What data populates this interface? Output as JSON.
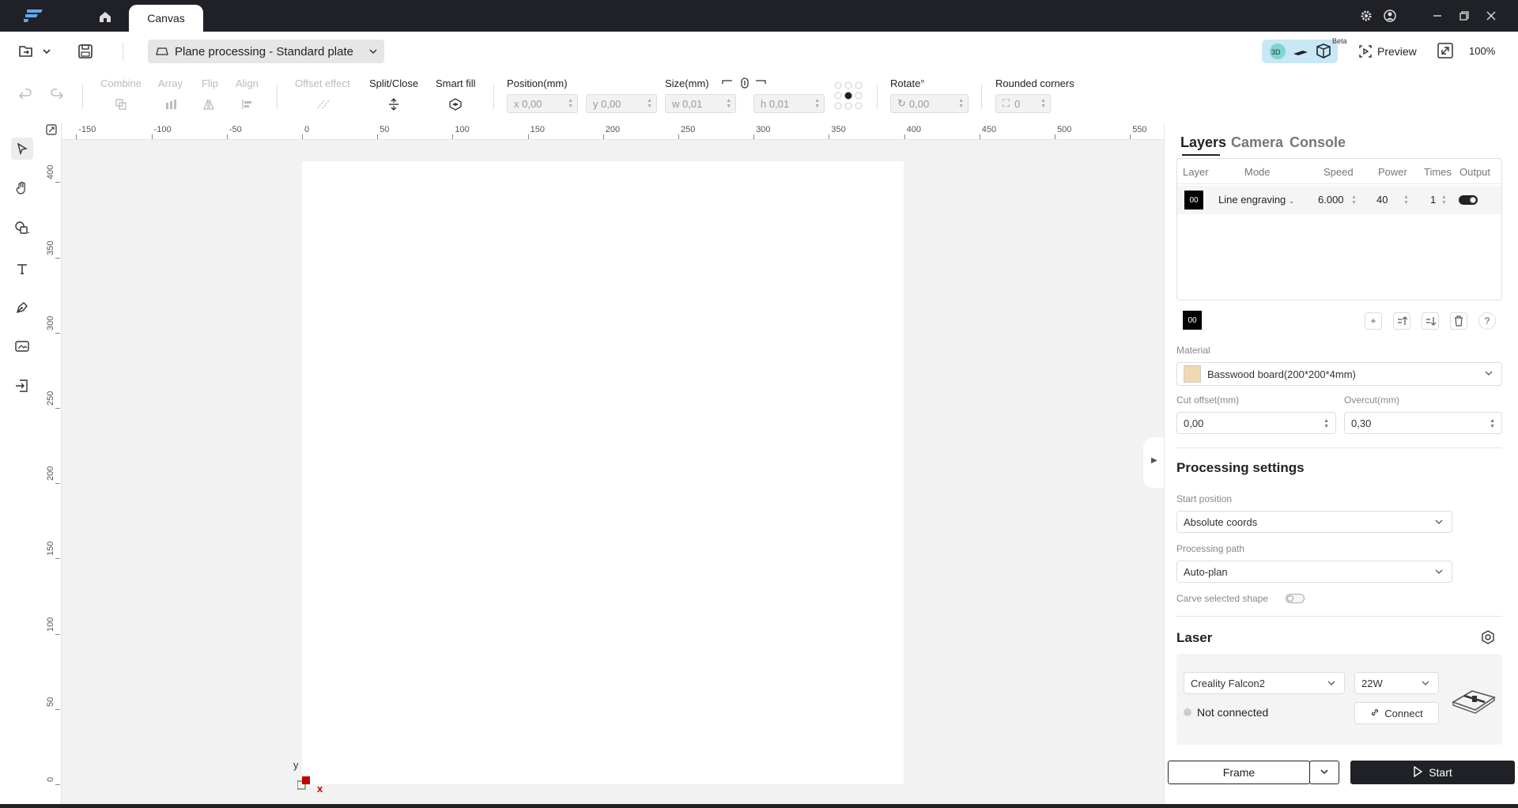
{
  "titlebar": {
    "tab_label": "Canvas"
  },
  "toolbar": {
    "plane_select": "Plane processing - Standard plate",
    "beta_label": "Beta",
    "preview_label": "Preview",
    "zoom_label": "100%"
  },
  "edit_toolbar": {
    "combine": "Combine",
    "array": "Array",
    "flip": "Flip",
    "align": "Align",
    "offset_effect": "Offset effect",
    "split_close": "Split/Close",
    "smart_fill": "Smart fill",
    "position_label": "Position(mm)",
    "pos_x": "x 0,00",
    "pos_y": "y 0,00",
    "size_label": "Size(mm)",
    "size_w": "w 0,01",
    "size_h": "h 0,01",
    "rotate_label": "Rotate°",
    "rotate_value": "0,00",
    "rounded_label": "Rounded corners",
    "rounded_value": "0"
  },
  "ruler": {
    "h_ticks": [
      "-150",
      "-100",
      "-50",
      "0",
      "50",
      "100",
      "150",
      "200",
      "250",
      "300",
      "350",
      "400",
      "450",
      "500",
      "550"
    ],
    "v_ticks": [
      "400",
      "350",
      "300",
      "250",
      "200",
      "150",
      "100",
      "50",
      "0"
    ],
    "axis_y": "y",
    "axis_x": "x"
  },
  "panel": {
    "tabs": [
      "Layers",
      "Camera",
      "Console"
    ],
    "table_headers": [
      "Layer",
      "Mode",
      "Speed",
      "Power",
      "Times",
      "Output"
    ],
    "row": {
      "layer": "00",
      "mode": "Line engraving",
      "speed": "6.000",
      "power": "40",
      "times": "1",
      "output_on": true
    },
    "chip_label": "00",
    "material_label": "Material",
    "material_value": "Basswood board(200*200*4mm)",
    "material_color": "#f0d9b0",
    "cut_offset_label": "Cut offset(mm)",
    "cut_offset_value": "0,00",
    "overcut_label": "Overcut(mm)",
    "overcut_value": "0,30",
    "processing_title": "Processing settings",
    "start_position_label": "Start position",
    "start_position_value": "Absolute coords",
    "processing_path_label": "Processing path",
    "processing_path_value": "Auto-plan",
    "carve_label": "Carve selected shape",
    "laser_title": "Laser",
    "machine_value": "Creality Falcon2",
    "power_value": "22W",
    "status_text": "Not connected",
    "connect_label": "Connect",
    "frame_label": "Frame",
    "start_label": "Start"
  }
}
